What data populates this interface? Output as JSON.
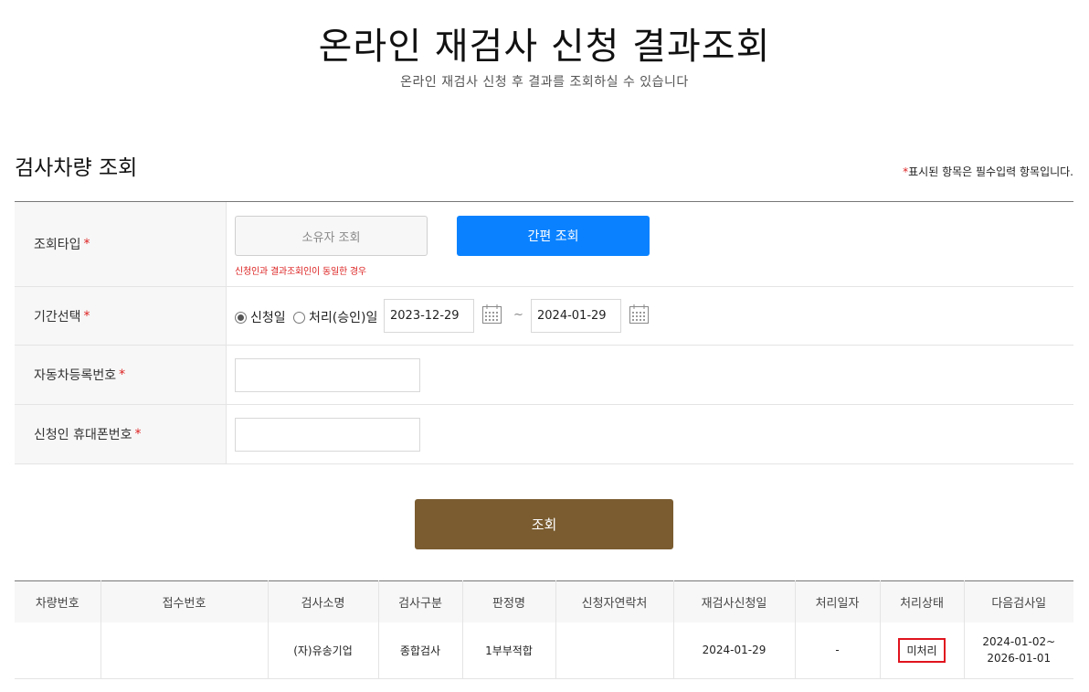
{
  "header": {
    "title": "온라인 재검사 신청 결과조회",
    "subtitle": "온라인 재검사 신청 후 결과를 조회하실 수 있습니다"
  },
  "section": {
    "title": "검사차량 조회",
    "required_note_star": "*",
    "required_note": "표시된 항목은 필수입력 항목입니다."
  },
  "form": {
    "required_star": "*",
    "query_type": {
      "label": "조회타입",
      "owner_button": "소유자 조회",
      "simple_button": "간편 조회",
      "hint": "신청인과 결과조회인이 동일한 경우"
    },
    "period": {
      "label": "기간선택",
      "option_apply": "신청일",
      "option_process": "처리(승인)일",
      "selected": "신청일",
      "start_date": "2023-12-29",
      "end_date": "2024-01-29",
      "separator": "~"
    },
    "car_number": {
      "label": "자동차등록번호",
      "value": ""
    },
    "phone": {
      "label": "신청인 휴대폰번호",
      "value": ""
    }
  },
  "search_button": "조회",
  "results": {
    "headers": [
      "차량번호",
      "접수번호",
      "검사소명",
      "검사구분",
      "판정명",
      "신청자연락처",
      "재검사신청일",
      "처리일자",
      "처리상태",
      "다음검사일"
    ],
    "rows": [
      {
        "car_number": "",
        "receipt_number": "",
        "station": "(자)유송기업",
        "inspection_type": "종합검사",
        "verdict": "1부부적합",
        "contact": "",
        "apply_date": "2024-01-29",
        "process_date": "-",
        "status": "미처리",
        "next_date_from": "2024-01-02~",
        "next_date_to": "2026-01-01"
      }
    ]
  },
  "colors": {
    "primary_blue": "#0a82ff",
    "search_brown": "#7a5c30",
    "required_red": "#dd2222",
    "status_highlight": "#e0141e"
  },
  "icons": {
    "calendar": "calendar-icon"
  }
}
